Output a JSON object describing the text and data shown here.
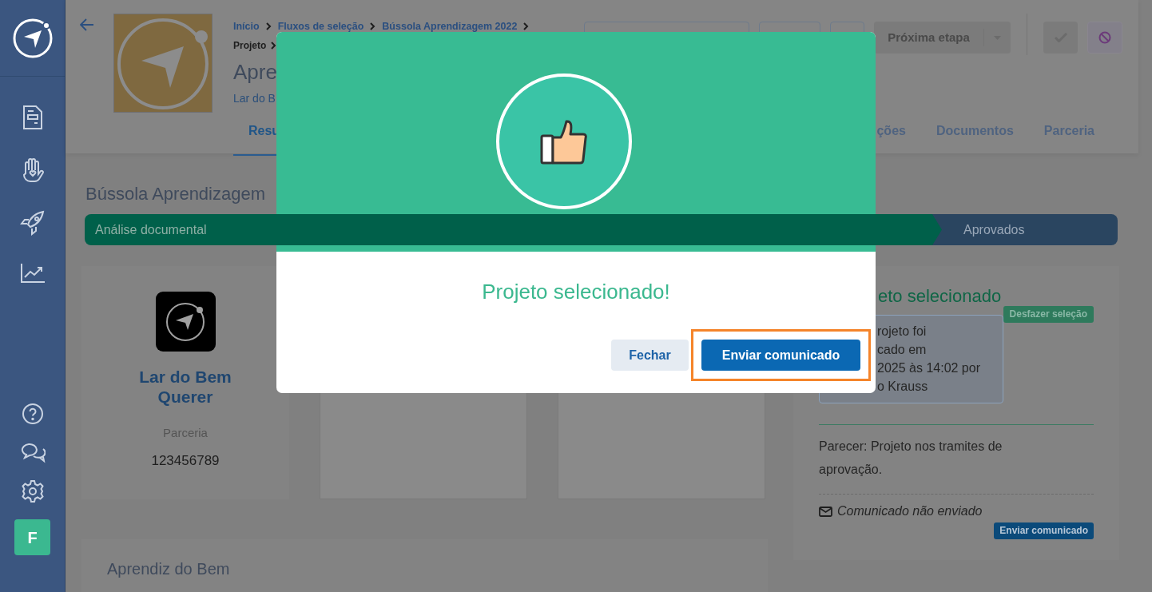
{
  "sidebar": {
    "avatar": "F"
  },
  "header": {
    "breadcrumb": [
      "Início",
      "Fluxos de seleção",
      "Bússola Aprendizagem 2022"
    ],
    "breadcrumb_current": "Projeto",
    "title": "Apre",
    "subtitle": "Lar do B",
    "tabs": [
      {
        "label": "Resu",
        "selected": true
      },
      {
        "label": "ções",
        "selected": false
      },
      {
        "label": "Documentos",
        "selected": false
      },
      {
        "label": "Parceria",
        "selected": false
      }
    ],
    "next_button": "Próxima etapa"
  },
  "section_title": "Bússola Aprendizagem",
  "steps": [
    {
      "label": "Análise documental",
      "kind": "done"
    },
    {
      "label": "Aprovados",
      "kind": "pending"
    }
  ],
  "organization_card": {
    "name": "Lar do Bem Querer",
    "field_label": "Parceria",
    "field_value": "123456789"
  },
  "status_card": {
    "title": "eto selecionado",
    "undo_badge": "Desfazer seleção",
    "note_lines": [
      "rojeto foi",
      "cado em",
      "2025 às 14:02 por",
      "o Krauss"
    ],
    "opinion": "Parecer: Projeto nos tramites de aprovação.",
    "notice": "Comunicado não enviado",
    "send_badge": "Enviar comunicado"
  },
  "bottom_card": {
    "title": "Aprendiz do Bem"
  },
  "modal": {
    "message": "Projeto selecionado!",
    "buttons": [
      {
        "label": "Fechar",
        "kind": "secondary",
        "highlighted": false
      },
      {
        "label": "Enviar comunicado",
        "kind": "primary",
        "highlighted": true
      }
    ]
  }
}
